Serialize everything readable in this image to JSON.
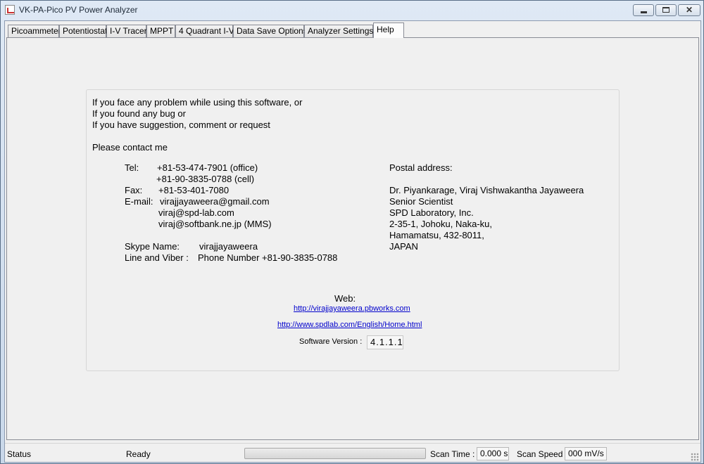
{
  "window": {
    "title": "VK-PA-Pico PV Power Analyzer",
    "controls": {
      "minimize": "minimize",
      "maximize": "maximize",
      "close": "✕"
    }
  },
  "tabs": [
    {
      "label": "Picoammeter"
    },
    {
      "label": "Potentiostat"
    },
    {
      "label": "I-V Tracer"
    },
    {
      "label": "MPPT"
    },
    {
      "label": "4 Quadrant I-V"
    },
    {
      "label": "Data Save Options"
    },
    {
      "label": "Analyzer Settings"
    },
    {
      "label": "Help",
      "active": true
    }
  ],
  "help": {
    "intro": [
      "If you face any problem while using this software, or",
      "If you found any bug or",
      "If you have suggestion, comment or request"
    ],
    "contact_heading": "Please contact me",
    "tel_label": "Tel:",
    "tel": [
      "+81-53-474-7901 (office)",
      "+81-90-3835-0788 (cell)"
    ],
    "fax_label": "Fax:",
    "fax": "+81-53-401-7080",
    "email_label": "E-mail:",
    "emails": [
      "virajjayaweera@gmail.com",
      "viraj@spd-lab.com",
      "viraj@softbank.ne.jp (MMS)"
    ],
    "skype_label": "Skype Name:",
    "skype": "virajjayaweera",
    "line_viber_label": "Line  and Viber :",
    "line_viber": "Phone Number +81-90-3835-0788",
    "postal_label": "Postal address:",
    "postal": [
      "Dr. Piyankarage, Viraj Vishwakantha Jayaweera",
      "Senior Scientist",
      "SPD Laboratory, Inc.",
      "2-35-1, Johoku, Naka-ku,",
      "Hamamatsu, 432-8011,",
      "JAPAN"
    ],
    "web_label": "Web:",
    "links": [
      "http://virajjayaweera.pbworks.com",
      "http://www.spdlab.com/English/Home.html"
    ],
    "version_label": "Software Version :",
    "version": "4.1.1.1"
  },
  "status": {
    "label": "Status",
    "state": "Ready",
    "progress": 0,
    "scan_time_label": "Scan Time :",
    "scan_time": "0.000 s",
    "scan_speed_label": "Scan Speed :",
    "scan_speed": "000 mV/s"
  }
}
